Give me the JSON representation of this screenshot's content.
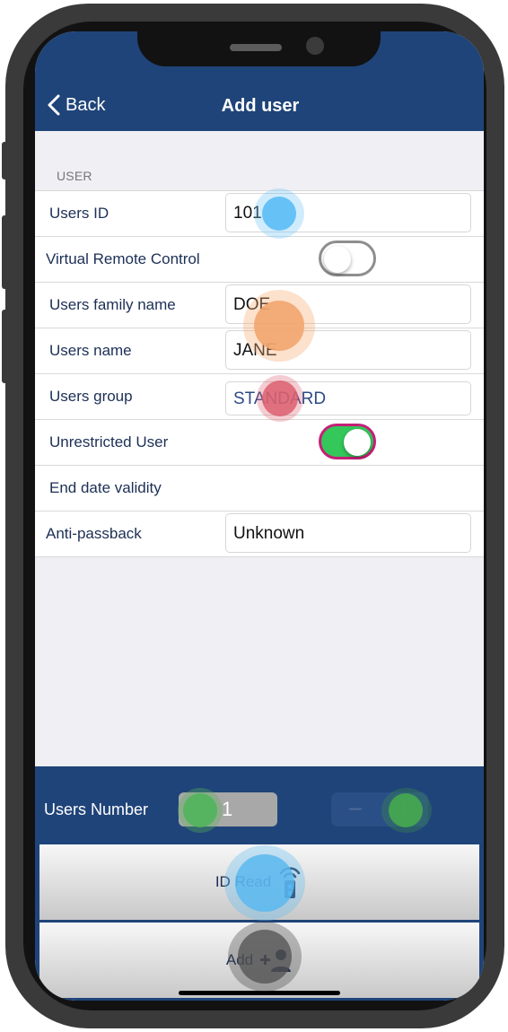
{
  "nav": {
    "back_label": "Back",
    "title": "Add user"
  },
  "form": {
    "section_header": "USER",
    "rows": [
      {
        "label": "Users ID",
        "value": "101"
      },
      {
        "label": "Virtual Remote Control",
        "toggle": false
      },
      {
        "label": "Users family name",
        "value": "DOE"
      },
      {
        "label": "Users name",
        "value": "JANE"
      },
      {
        "label": "Users group",
        "value": "STANDARD"
      },
      {
        "label": "Unrestricted User",
        "toggle": true
      },
      {
        "label": "End date validity",
        "value": ""
      },
      {
        "label": "Anti-passback",
        "value": "Unknown"
      }
    ]
  },
  "bottom": {
    "users_number_label": "Users Number",
    "users_number_value": "1",
    "minus_symbol": "−",
    "plus_symbol": "+",
    "id_read_label": "ID Read",
    "add_label": "Add"
  },
  "colors": {
    "header": "#1f4479",
    "toggle_on": "#34c759",
    "toggle_on_border": "#c51f78",
    "label_text": "#1c2f55"
  },
  "icons": {
    "back": "chevron-left-icon",
    "id_read": "remote-signal-icon",
    "add": "add-user-icon"
  }
}
